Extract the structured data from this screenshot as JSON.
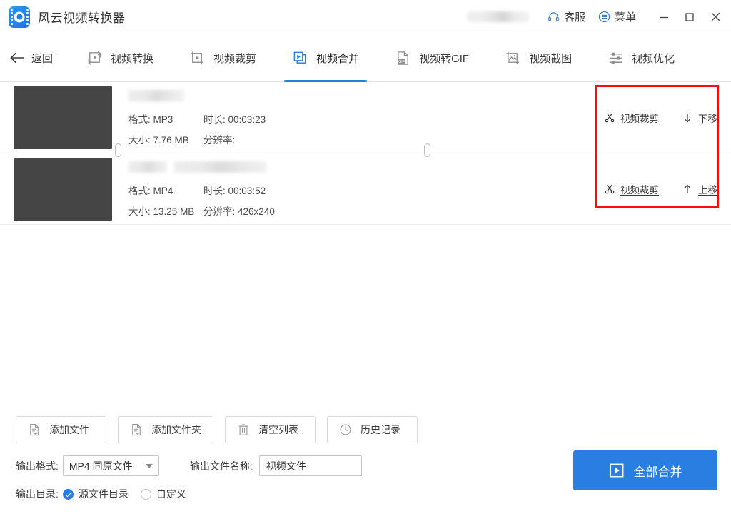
{
  "window": {
    "app_title": "风云视频转换器",
    "logo_icon": "app-logo-film-record-icon",
    "account_blurred": "",
    "support_label": "客服",
    "support_icon": "headset-icon",
    "menu_label": "菜单",
    "menu_icon": "list-menu-icon",
    "minimize_icon": "minimize-icon",
    "maximize_icon": "maximize-icon",
    "close_icon": "close-icon"
  },
  "nav": {
    "back_label": "返回",
    "back_icon": "arrow-left-icon",
    "tabs": [
      {
        "label": "视频转换",
        "icon": "video-convert-icon",
        "active": false
      },
      {
        "label": "视频裁剪",
        "icon": "video-crop-icon",
        "active": false
      },
      {
        "label": "视频合并",
        "icon": "video-merge-icon",
        "active": true
      },
      {
        "label": "视频转GIF",
        "icon": "gif-file-icon",
        "active": false
      },
      {
        "label": "视频截图",
        "icon": "image-capture-icon",
        "active": false
      },
      {
        "label": "视频优化",
        "icon": "sliders-icon",
        "active": false
      }
    ],
    "accent_color": "#2a7de1"
  },
  "file_list": {
    "fields": {
      "format": "格式:",
      "duration": "时长:",
      "size": "大小:",
      "resolution": "分辨率:"
    },
    "rows": [
      {
        "format": "MP3",
        "duration": "00:03:23",
        "size": "7.76 MB",
        "resolution": "",
        "name_blurred": true,
        "actions": [
          {
            "label": "视频裁剪",
            "icon": "scissors-icon"
          },
          {
            "label": "下移",
            "icon": "arrow-down-icon"
          }
        ]
      },
      {
        "format": "MP4",
        "duration": "00:03:52",
        "size": "13.25 MB",
        "resolution": "426x240",
        "name_blurred": true,
        "actions": [
          {
            "label": "视频裁剪",
            "icon": "scissors-icon"
          },
          {
            "label": "上移",
            "icon": "arrow-up-icon"
          }
        ]
      }
    ],
    "annotation_box_color": "#fb0d0d"
  },
  "bottom": {
    "buttons": [
      {
        "label": "添加文件",
        "icon": "add-file-icon"
      },
      {
        "label": "添加文件夹",
        "icon": "add-folder-icon"
      },
      {
        "label": "清空列表",
        "icon": "trash-icon"
      },
      {
        "label": "历史记录",
        "icon": "clock-icon"
      }
    ],
    "output_format_label": "输出格式:",
    "output_format_value": "MP4 同原文件",
    "output_name_label": "输出文件名称:",
    "output_name_value": "视频文件",
    "output_dir_label": "输出目录:",
    "dir_options": [
      {
        "label": "源文件目录",
        "selected": true
      },
      {
        "label": "自定义",
        "selected": false
      }
    ],
    "merge_label": "全部合并",
    "merge_icon": "play-square-icon",
    "merge_color": "#2a7de1"
  }
}
